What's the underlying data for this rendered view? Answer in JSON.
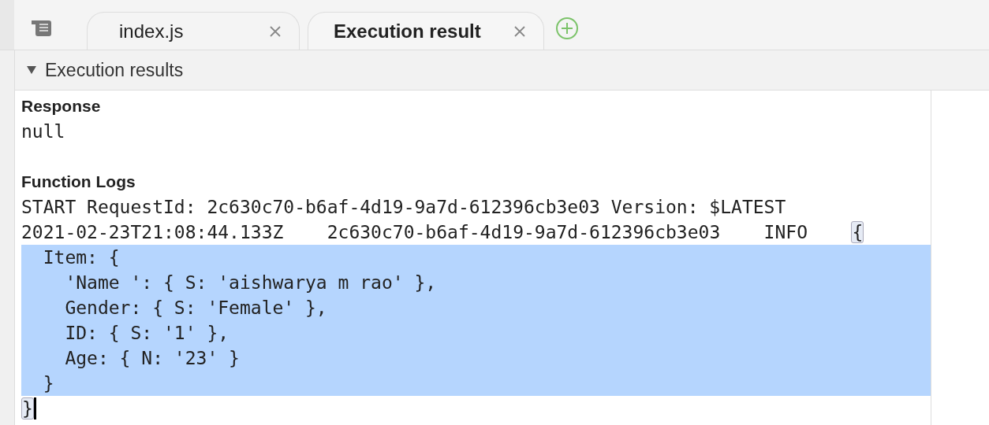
{
  "tabs": [
    {
      "label": "index.js",
      "selected": false
    },
    {
      "label": "Execution result",
      "selected": true
    }
  ],
  "panel": {
    "title": "Execution results",
    "expanded": true
  },
  "response": {
    "heading": "Response",
    "value": "null"
  },
  "logs": {
    "heading": "Function Logs",
    "lines": [
      {
        "text": "START RequestId: 2c630c70-b6af-4d19-9a7d-612396cb3e03 Version: $LATEST",
        "selected": false
      },
      {
        "text": "2021-02-23T21:08:44.133Z\t2c630c70-b6af-4d19-9a7d-612396cb3e03\tINFO\t",
        "bracket": "{",
        "selected": false
      },
      {
        "text": "  Item: {",
        "selected": true
      },
      {
        "text": "    'Name ': { S: 'aishwarya m rao' },",
        "selected": true
      },
      {
        "text": "    Gender: { S: 'Female' },",
        "selected": true
      },
      {
        "text": "    ID: { S: '1' },",
        "selected": true
      },
      {
        "text": "    Age: { N: '23' }",
        "selected": true
      },
      {
        "text": "  }",
        "selected": true
      },
      {
        "bracket": "}",
        "cursor": true,
        "selected": false
      }
    ]
  }
}
